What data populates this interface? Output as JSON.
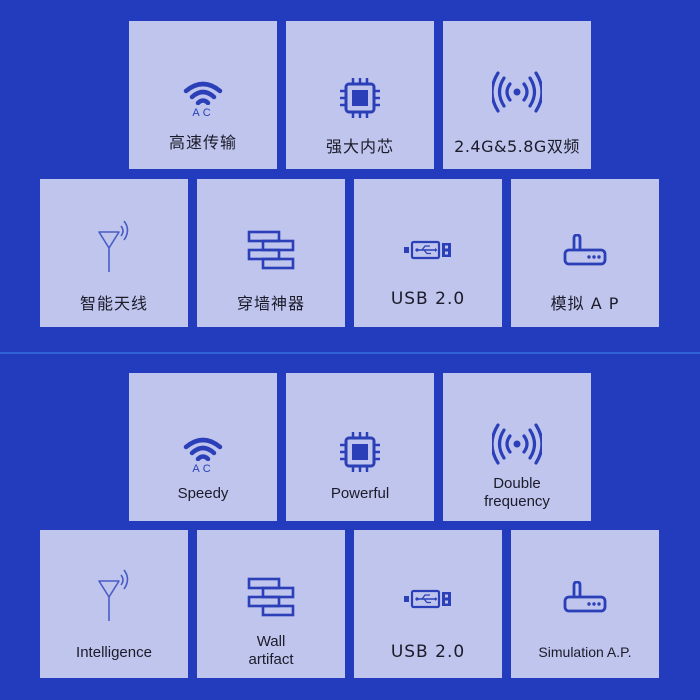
{
  "colors": {
    "background": "#233bbd",
    "tile": "#bfc5ec",
    "icon": "#2a3fb8",
    "text": "#1b1b2a"
  },
  "chinese_section": {
    "row1": [
      {
        "icon": "wifi-ac-icon",
        "icon_text": "AC",
        "label": "高速传输"
      },
      {
        "icon": "chip-icon",
        "label": "强大内芯"
      },
      {
        "icon": "broadcast-signal-icon",
        "label": "2.4G&5.8G双频"
      }
    ],
    "row2": [
      {
        "icon": "antenna-icon",
        "label": "智能天线"
      },
      {
        "icon": "brick-wall-icon",
        "label": "穿墙神器"
      },
      {
        "icon": "usb-icon",
        "label": "USB 2.0"
      },
      {
        "icon": "router-icon",
        "label": "模拟 A P"
      }
    ]
  },
  "english_section": {
    "row1": [
      {
        "icon": "wifi-ac-icon",
        "icon_text": "AC",
        "label": "Speedy"
      },
      {
        "icon": "chip-icon",
        "label": "Powerful"
      },
      {
        "icon": "broadcast-signal-icon",
        "label_line1": "Double",
        "label_line2": "frequency"
      }
    ],
    "row2": [
      {
        "icon": "antenna-icon",
        "label": "Intelligence"
      },
      {
        "icon": "brick-wall-icon",
        "label_line1": "Wall",
        "label_line2": "artifact"
      },
      {
        "icon": "usb-icon",
        "label": "USB 2.0"
      },
      {
        "icon": "router-icon",
        "label": "Simulation A.P."
      }
    ]
  }
}
